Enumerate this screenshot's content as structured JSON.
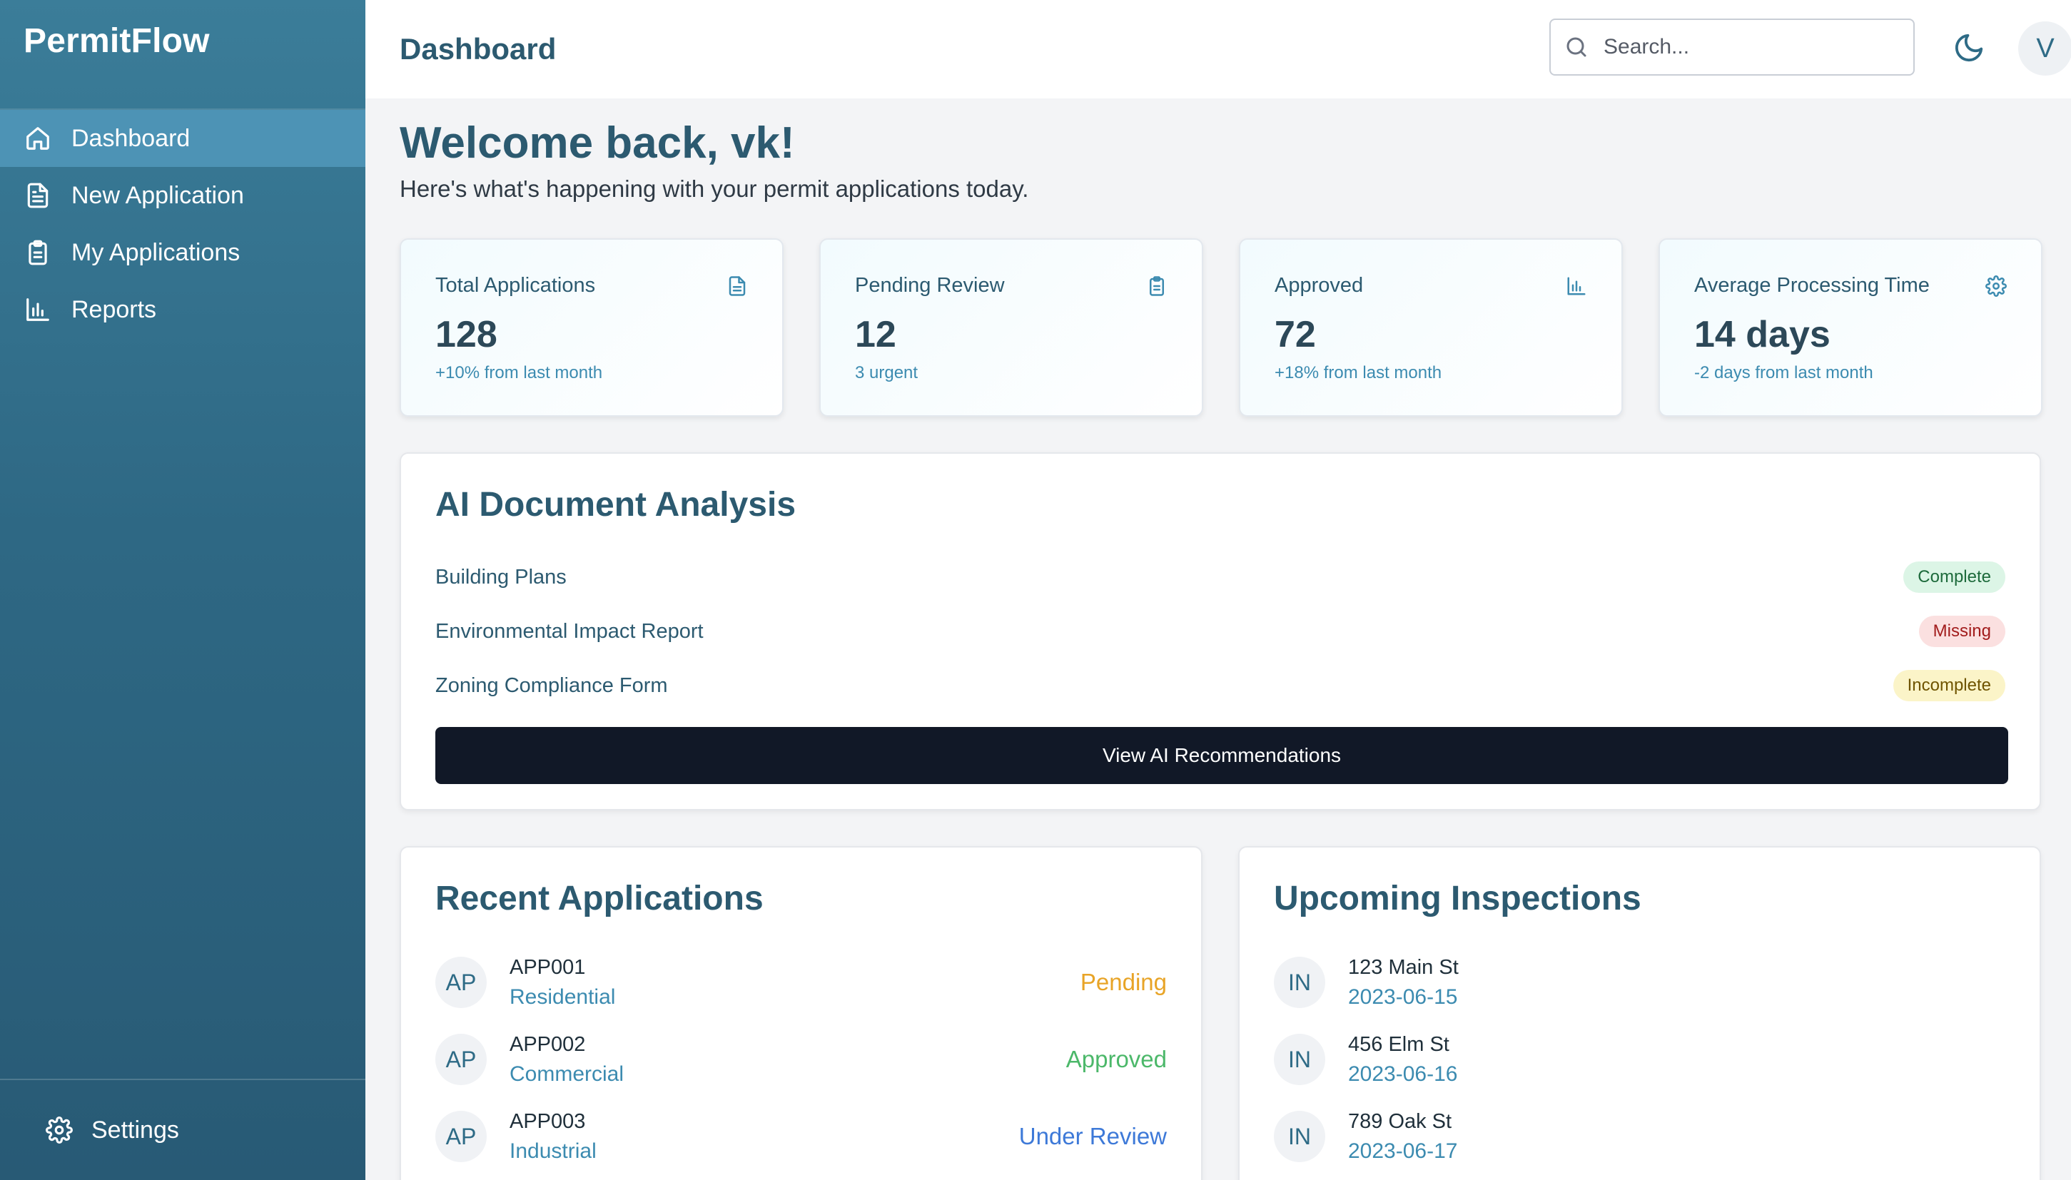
{
  "app": {
    "brand": "PermitFlow"
  },
  "sidebar": {
    "items": [
      {
        "label": "Dashboard",
        "icon": "home-icon",
        "active": true
      },
      {
        "label": "New Application",
        "icon": "file-text-icon"
      },
      {
        "label": "My Applications",
        "icon": "clipboard-icon"
      },
      {
        "label": "Reports",
        "icon": "bar-chart-icon"
      }
    ],
    "settings_label": "Settings"
  },
  "header": {
    "title": "Dashboard",
    "search_placeholder": "Search...",
    "avatar_initial": "V"
  },
  "welcome": {
    "heading": "Welcome back, vk!",
    "subtitle": "Here's what's happening with your permit applications today."
  },
  "stats": [
    {
      "label": "Total Applications",
      "value": "128",
      "sub": "+10% from last month",
      "icon": "file-text-icon"
    },
    {
      "label": "Pending Review",
      "value": "12",
      "sub": "3 urgent",
      "icon": "clipboard-icon"
    },
    {
      "label": "Approved",
      "value": "72",
      "sub": "+18% from last month",
      "icon": "bar-chart-icon"
    },
    {
      "label": "Average Processing Time",
      "value": "14 days",
      "sub": "-2 days from last month",
      "icon": "gear-icon"
    }
  ],
  "ai_analysis": {
    "title": "AI Document Analysis",
    "documents": [
      {
        "name": "Building Plans",
        "status": "Complete"
      },
      {
        "name": "Environmental Impact Report",
        "status": "Missing"
      },
      {
        "name": "Zoning Compliance Form",
        "status": "Incomplete"
      }
    ],
    "button_label": "View AI Recommendations"
  },
  "recent_applications": {
    "title": "Recent Applications",
    "items": [
      {
        "initials": "AP",
        "id": "APP001",
        "type": "Residential",
        "status": "Pending"
      },
      {
        "initials": "AP",
        "id": "APP002",
        "type": "Commercial",
        "status": "Approved"
      },
      {
        "initials": "AP",
        "id": "APP003",
        "type": "Industrial",
        "status": "Under Review"
      }
    ]
  },
  "upcoming_inspections": {
    "title": "Upcoming Inspections",
    "items": [
      {
        "initials": "IN",
        "address": "123 Main St",
        "date": "2023-06-15"
      },
      {
        "initials": "IN",
        "address": "456 Elm St",
        "date": "2023-06-16"
      },
      {
        "initials": "IN",
        "address": "789 Oak St",
        "date": "2023-06-17"
      }
    ]
  },
  "colors": {
    "sidebar": "#2e6884",
    "active_nav": "#4d93b5",
    "accent_text": "#2c5a70",
    "button_dark": "#111827"
  }
}
